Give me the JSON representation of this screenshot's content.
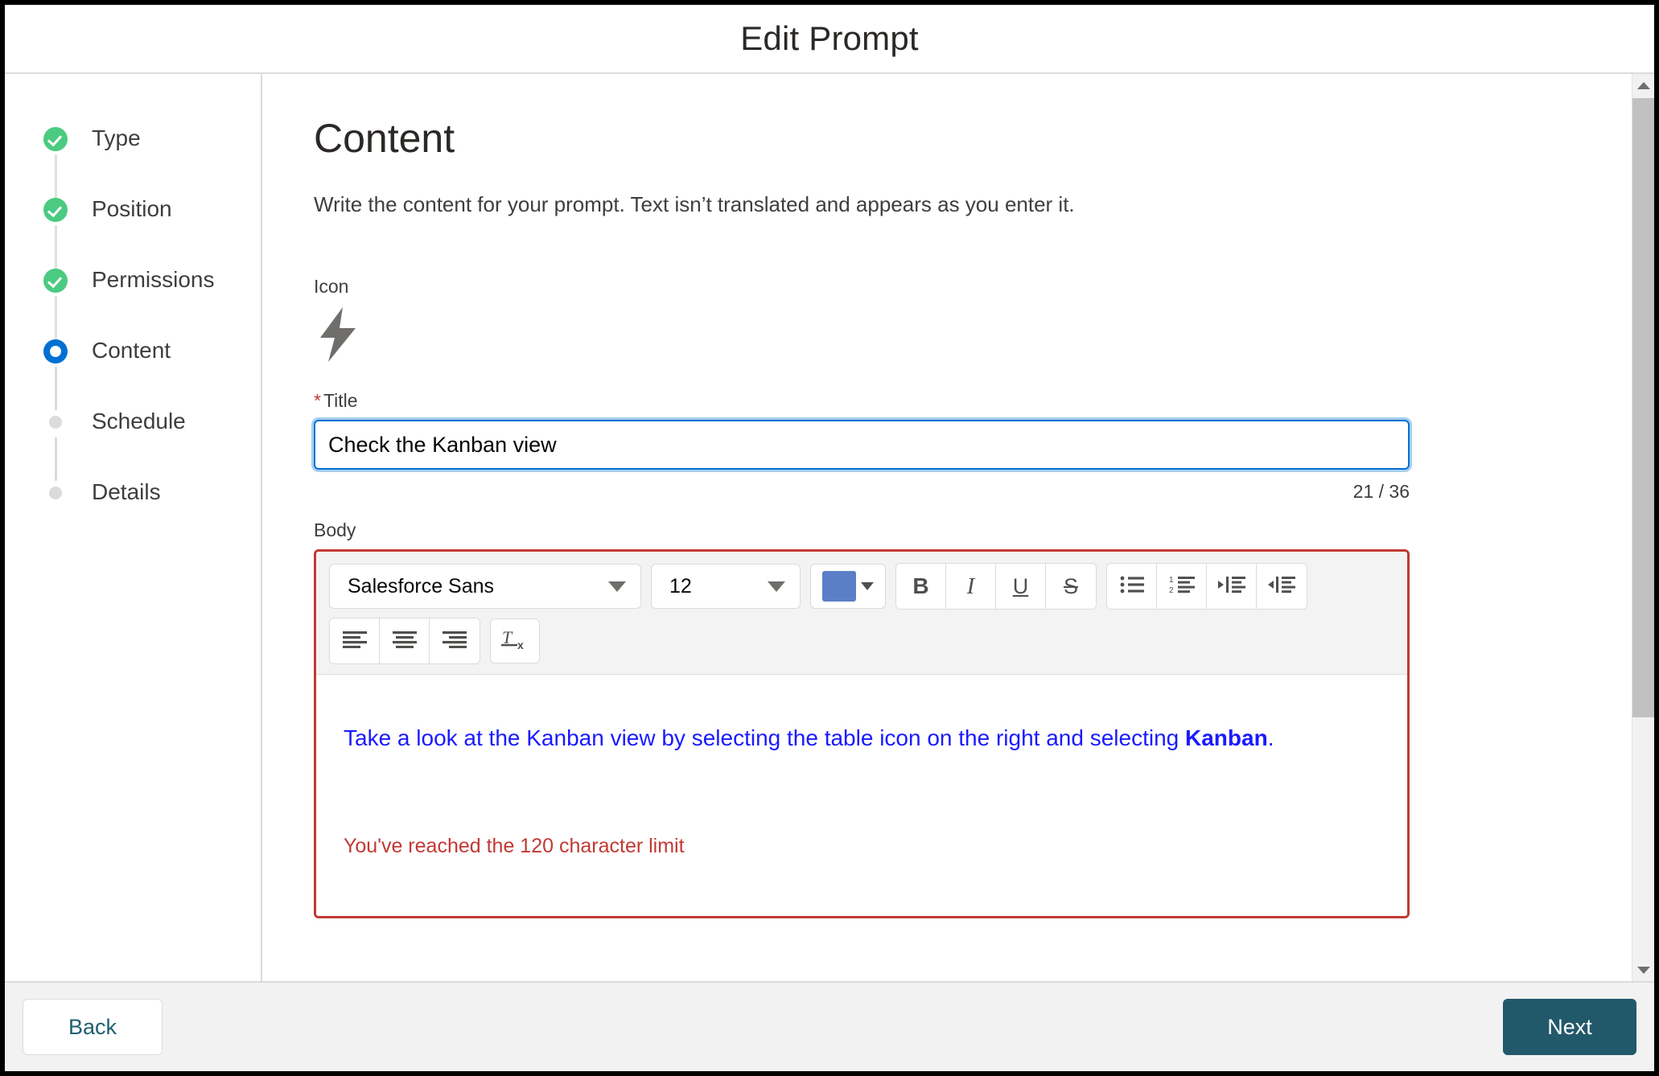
{
  "header": {
    "title": "Edit Prompt"
  },
  "steps": [
    {
      "label": "Type",
      "state": "done"
    },
    {
      "label": "Position",
      "state": "done"
    },
    {
      "label": "Permissions",
      "state": "done"
    },
    {
      "label": "Content",
      "state": "current"
    },
    {
      "label": "Schedule",
      "state": "todo"
    },
    {
      "label": "Details",
      "state": "todo"
    }
  ],
  "content": {
    "section_title": "Content",
    "section_desc": "Write the content for your prompt. Text isn’t translated and appears as you enter it.",
    "icon_label": "Icon",
    "icon_name": "lightning-bolt-icon",
    "title_label": "Title",
    "title_required_mark": "*",
    "title_value": "Check the Kanban view",
    "title_placeholder": "",
    "char_counter": "21 / 36",
    "body_label": "Body"
  },
  "editor": {
    "font_family_value": "Salesforce Sans",
    "font_size_value": "12",
    "text_color_hex": "#5b7fc7",
    "buttons": {
      "bold": "B",
      "italic": "I",
      "underline": "U",
      "strikethrough": "S",
      "remove_format": "T"
    },
    "body_text_prefix": "Take a look at the Kanban view by selecting the table icon on the right and selecting ",
    "body_text_bold": "Kanban",
    "body_text_suffix": ".",
    "error_message": "You've reached the 120 character limit",
    "error_color_hex": "#c23934",
    "body_text_color_hex": "#1a1aff"
  },
  "footer": {
    "back_label": "Back",
    "next_label": "Next",
    "next_color_hex": "#22596a"
  },
  "theme": {
    "done_color_hex": "#4bca81",
    "current_color_hex": "#0070d2",
    "todo_color_hex": "#dddbda"
  }
}
